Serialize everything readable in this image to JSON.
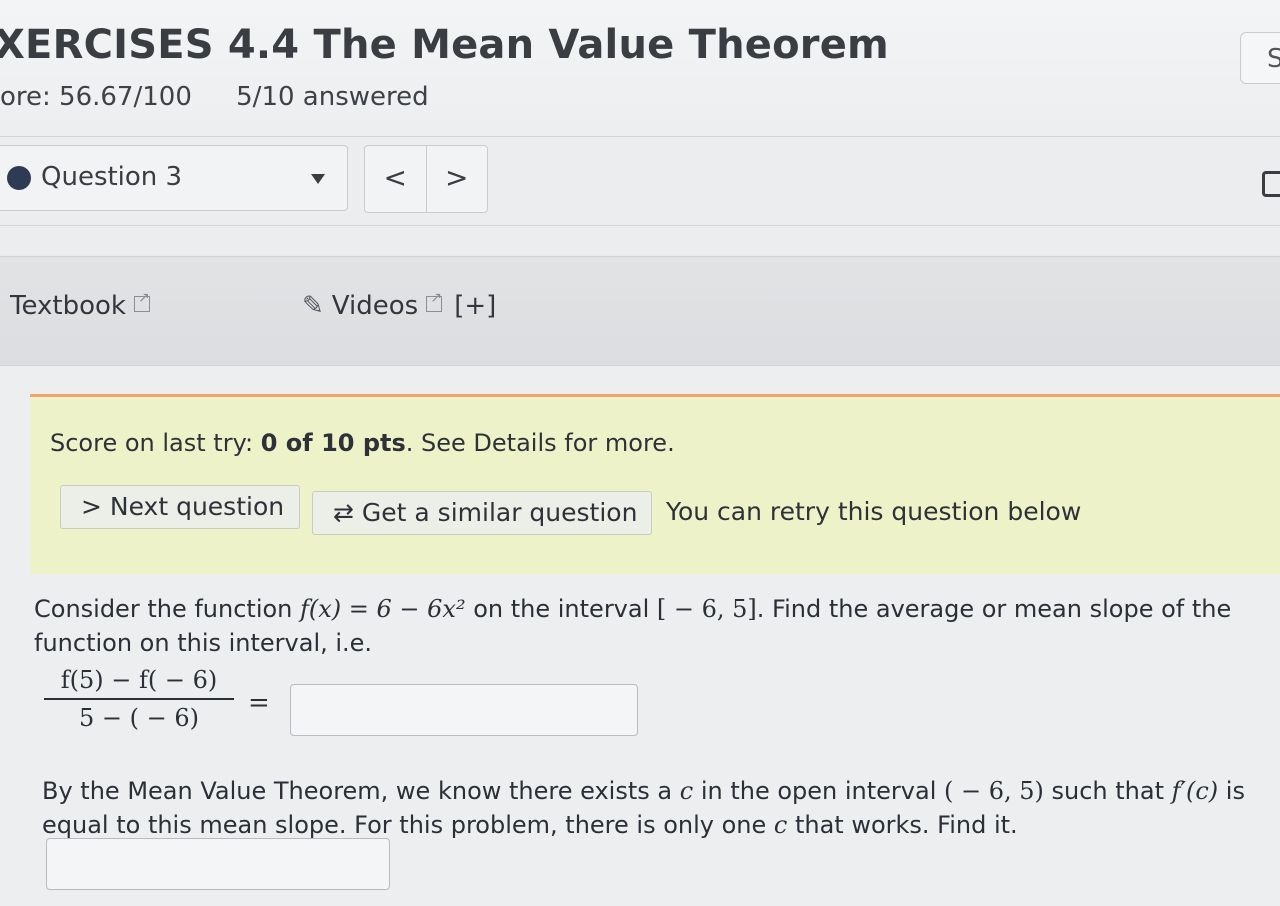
{
  "header": {
    "title": "XERCISES 4.4 The Mean Value Theorem",
    "score": "ore: 56.67/100",
    "answered": "5/10 answered",
    "corner_button": "S"
  },
  "question_nav": {
    "selected": "Question 3",
    "prev_label": "<",
    "next_label": ">"
  },
  "resources": {
    "textbook": "Textbook",
    "videos": "Videos",
    "expand": "[+]"
  },
  "banner": {
    "score_prefix": "Score on last try: ",
    "score_value": "0 of 10 pts",
    "score_suffix": ". See Details for more.",
    "next_button": "> Next question",
    "similar_button": "Get a similar question",
    "retry_text": "You can retry this question below"
  },
  "problem": {
    "line1_prefix": "Consider the function ",
    "function": "f(x) = 6 − 6x²",
    "line1_mid": " on the interval ",
    "interval": "[ − 6, 5]",
    "line1_suffix": ". Find the average or mean slope of the function on this interval, i.e.",
    "fraction_numerator": "f(5) − f( − 6)",
    "fraction_denominator": "5 − ( − 6)",
    "equals": "=",
    "mvt_prefix": "By the Mean Value Theorem, we know there exists a ",
    "mvt_c": "c",
    "mvt_mid": " in the open interval ",
    "open_interval": "( − 6, 5)",
    "mvt_mid2": " such that ",
    "derivative": "f′(c)",
    "mvt_suffix": " is equal to this mean slope. For this problem, there is only one ",
    "mvt_c2": "c",
    "mvt_end": " that works. Find it."
  },
  "inputs": {
    "mean_slope_value": "",
    "c_value": ""
  }
}
